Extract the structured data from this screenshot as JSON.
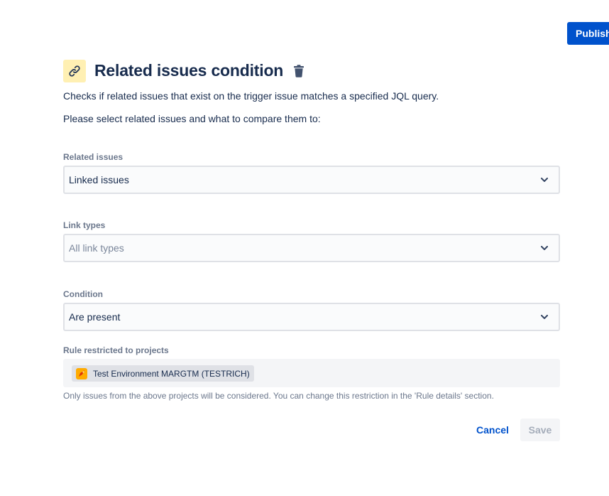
{
  "toolbar": {
    "publish_label": "Publish"
  },
  "condition": {
    "title": "Related issues condition",
    "icon": "link-icon",
    "description": "Checks if related issues that exist on the trigger issue matches a specified JQL query.",
    "prompt": "Please select related issues and what to compare them to:"
  },
  "fields": {
    "related_issues": {
      "label": "Related issues",
      "value": "Linked issues"
    },
    "link_types": {
      "label": "Link types",
      "placeholder": "All link types"
    },
    "condition": {
      "label": "Condition",
      "value": "Are present"
    },
    "projects": {
      "label": "Rule restricted to projects",
      "tag": "Test Environment MARGTM (TESTRICH)",
      "help": "Only issues from the above projects will be considered. You can change this restriction in the 'Rule details' section."
    }
  },
  "actions": {
    "cancel_label": "Cancel",
    "save_label": "Save"
  },
  "colors": {
    "primary": "#0052cc",
    "icon_bg": "#fff0b3",
    "project_avatar": "#ffab00"
  }
}
